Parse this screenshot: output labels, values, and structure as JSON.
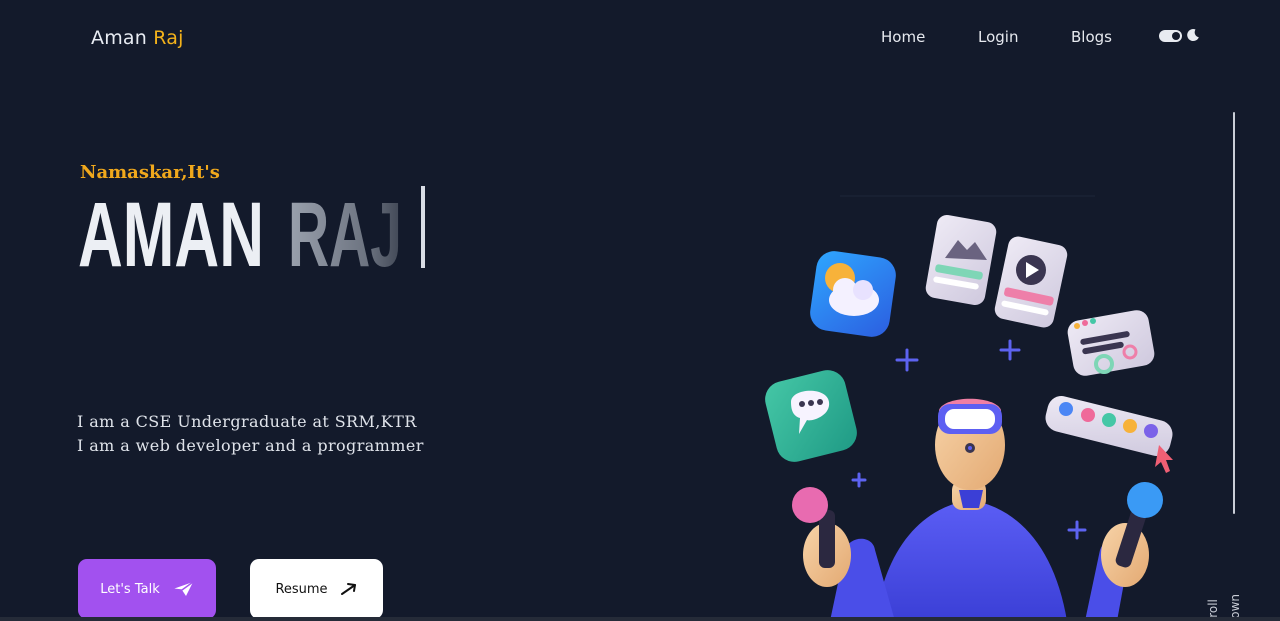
{
  "header": {
    "logo_first": "Aman",
    "logo_second": "Raj",
    "nav": [
      "Home",
      "Login",
      "Blogs"
    ]
  },
  "hero": {
    "greeting": "Namaskar,It's",
    "name_first": "AMAN",
    "name_second": "RAJ",
    "bio_lines": [
      "I am a CSE Undergraduate at SRM,KTR",
      "I am a web developer and a programmer"
    ],
    "cta_primary": "Let's Talk",
    "cta_secondary": "Resume"
  },
  "scroll_hint": {
    "word_one": "Scroll",
    "word_two": "Down"
  },
  "colors": {
    "background": "#131a2b",
    "accent_yellow": "#f3b21b",
    "cta_purple": "#a251ef"
  },
  "icons": [
    "sun-moon-toggle",
    "moon-icon",
    "paper-plane-icon",
    "arrow-up-right-icon"
  ]
}
